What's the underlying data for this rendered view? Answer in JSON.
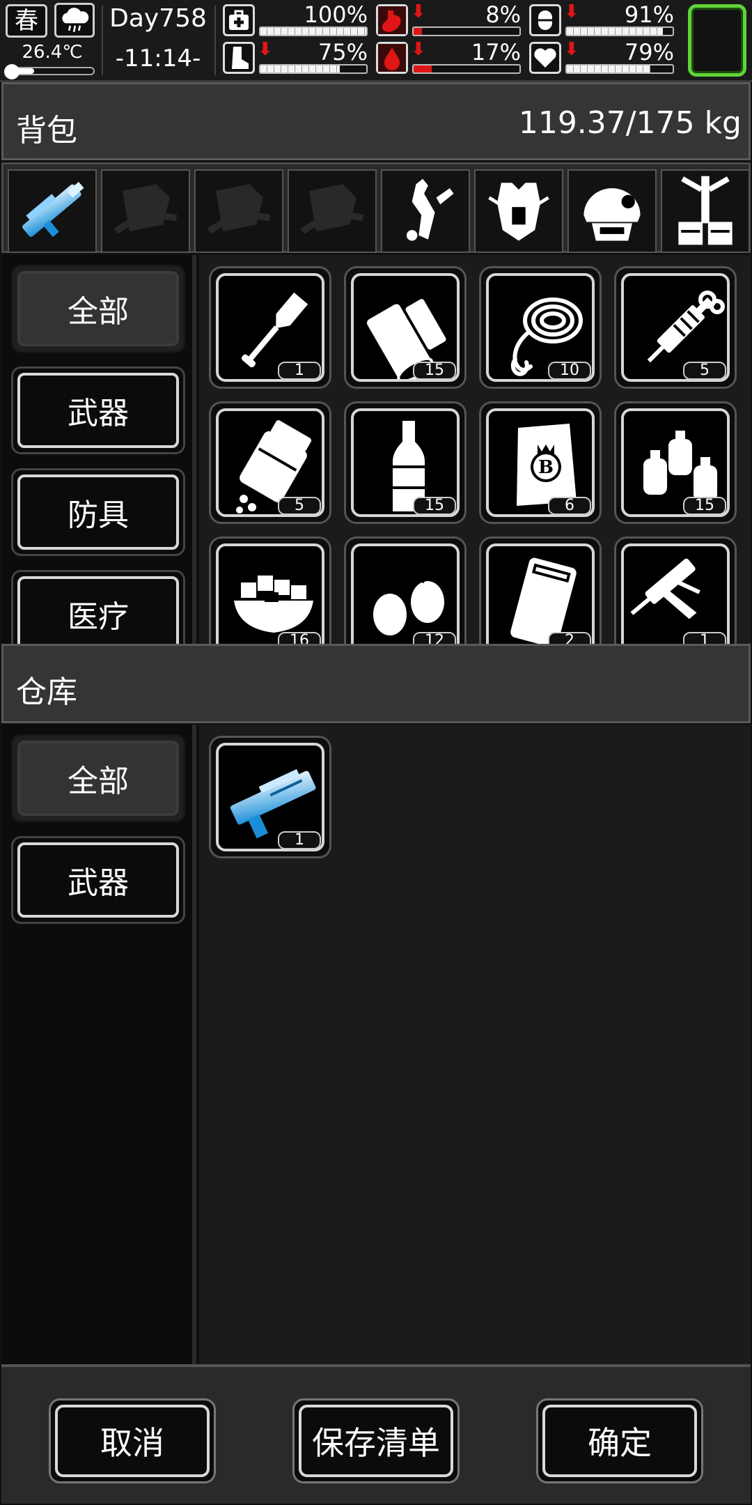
{
  "status": {
    "season": "春",
    "weather_icon": "rain-cloud-icon",
    "temperature": "26.4℃",
    "temperature_level": 0.3,
    "day": "Day758",
    "time": "-11:14-",
    "stats": [
      {
        "name": "health",
        "icon": "medkit-icon",
        "value": "100%",
        "level": 1.0,
        "falling": false
      },
      {
        "name": "hunger",
        "icon": "stomach-icon",
        "value": "8%",
        "level": 0.08,
        "falling": true
      },
      {
        "name": "sanity",
        "icon": "pill-icon",
        "value": "91%",
        "level": 0.91,
        "falling": true
      },
      {
        "name": "stamina",
        "icon": "leg-icon",
        "value": "75%",
        "level": 0.75,
        "falling": true
      },
      {
        "name": "thirst",
        "icon": "water-drop-icon",
        "value": "17%",
        "level": 0.17,
        "falling": true
      },
      {
        "name": "mood",
        "icon": "heart-icon",
        "value": "79%",
        "level": 0.79,
        "falling": true
      }
    ],
    "warning_color": "#e01616",
    "accent_green": "#5fd33a"
  },
  "backpack": {
    "title": "背包",
    "weight": "119.37/175 kg",
    "equipment": [
      "plasma-rifle-icon",
      "empty-armor-slot-icon",
      "empty-armor-slot-icon",
      "empty-armor-slot-icon",
      "backpack-gear-icon",
      "armor-vest-icon",
      "helmet-icon",
      "exoskeleton-icon"
    ],
    "categories": [
      {
        "label": "全部",
        "active": true
      },
      {
        "label": "武器",
        "active": false
      },
      {
        "label": "防具",
        "active": false
      },
      {
        "label": "医疗",
        "active": false
      }
    ],
    "items": [
      {
        "icon": "shovel-icon",
        "qty": "1"
      },
      {
        "icon": "bandage-roll-icon",
        "qty": "15"
      },
      {
        "icon": "rope-icon",
        "qty": "10"
      },
      {
        "icon": "syringe-icon",
        "qty": "5"
      },
      {
        "icon": "pill-bottle-icon",
        "qty": "5"
      },
      {
        "icon": "liquor-bottle-icon",
        "qty": "15"
      },
      {
        "icon": "coin-pouch-icon",
        "qty": "6"
      },
      {
        "icon": "spray-cans-icon",
        "qty": "15"
      },
      {
        "icon": "food-bowl-icon",
        "qty": "16"
      },
      {
        "icon": "nuts-icon",
        "qty": "12"
      },
      {
        "icon": "cooler-box-icon",
        "qty": "2"
      },
      {
        "icon": "caulk-gun-icon",
        "qty": "1"
      }
    ]
  },
  "warehouse": {
    "title": "仓库",
    "categories": [
      {
        "label": "全部",
        "active": true
      },
      {
        "label": "武器",
        "active": false
      }
    ],
    "items": [
      {
        "icon": "plasma-shotgun-icon",
        "qty": "1"
      }
    ]
  },
  "footer": {
    "cancel": "取消",
    "save_list": "保存清单",
    "confirm": "确定"
  }
}
